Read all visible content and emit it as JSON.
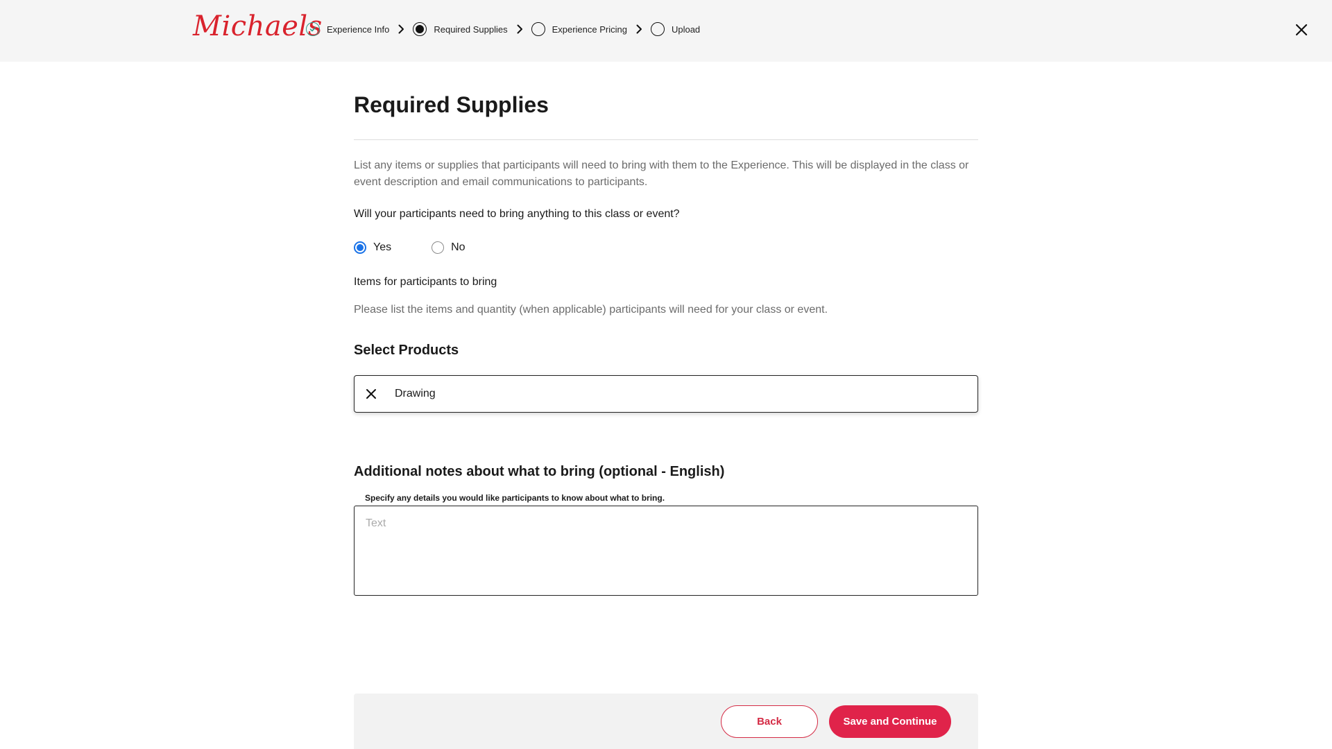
{
  "brand": {
    "logo_text": "Michaels",
    "accent": "#d9232d",
    "primary_button": "#e0234a",
    "done_step_color": "#2f9e8a",
    "radio_checked_color": "#1a73e8"
  },
  "stepper": {
    "steps": [
      {
        "label": "Experience Info",
        "state": "done",
        "icon": "check-circle-icon"
      },
      {
        "label": "Required Supplies",
        "state": "current",
        "icon": "filled-circle-icon"
      },
      {
        "label": "Experience Pricing",
        "state": "todo",
        "icon": "empty-circle-icon"
      },
      {
        "label": "Upload",
        "state": "todo",
        "icon": "empty-circle-icon"
      }
    ],
    "separator_icon": "chevron-right-icon"
  },
  "header": {
    "close_icon": "close-icon"
  },
  "main": {
    "title": "Required Supplies",
    "intro": "List any items or supplies that participants will need to bring with them to the Experience. This will be displayed in the class or event description and email communications to participants.",
    "question": "Will your participants need to bring anything to this class or event?",
    "options": [
      {
        "label": "Yes",
        "checked": true
      },
      {
        "label": "No",
        "checked": false
      }
    ],
    "items_label": "Items for participants to bring",
    "items_help": "Please list the items and quantity (when applicable) participants will need for your class or event.",
    "select_products": {
      "title": "Select Products",
      "value": "Drawing",
      "clear_icon": "clear-icon"
    },
    "notes": {
      "title": "Additional notes about what to bring (optional - English)",
      "help": "Specify any details you would like participants to know about what to bring.",
      "placeholder": "Text",
      "value": ""
    }
  },
  "footer": {
    "back_label": "Back",
    "save_label": "Save and Continue"
  }
}
